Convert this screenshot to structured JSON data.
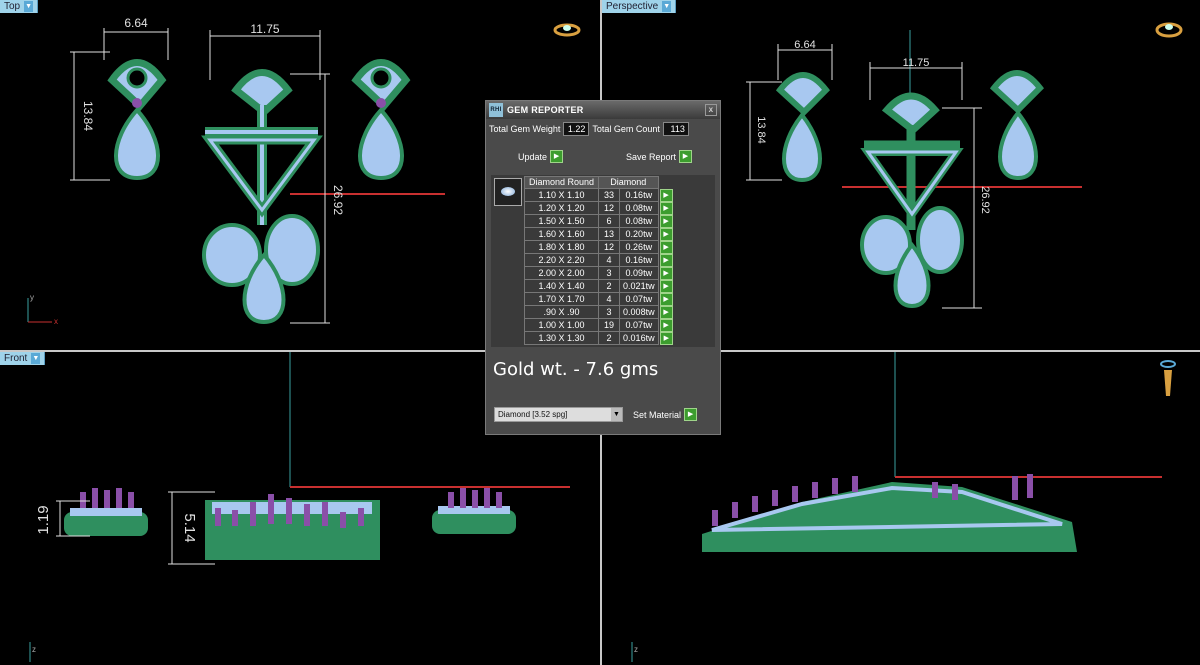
{
  "viewports": {
    "top_label": "Top",
    "perspective_label": "Perspective",
    "front_label": "Front",
    "right_label": ""
  },
  "dimensions": {
    "top_left_width": "6.64",
    "top_center_width": "11.75",
    "top_left_height": "13.84",
    "top_center_height": "26.92",
    "persp_left_width": "6.64",
    "persp_center_width": "11.75",
    "persp_left_height": "13.84",
    "persp_center_height": "26.92",
    "front_left_height": "1.19",
    "front_center_height": "5.14"
  },
  "axes": {
    "top_x": "x",
    "top_y": "y",
    "front_z": "z",
    "right_z": "z"
  },
  "gem_reporter": {
    "title": "GEM REPORTER",
    "logo": "RHI",
    "close": "x",
    "total_weight_label": "Total Gem Weight",
    "total_weight": "1.22",
    "total_count_label": "Total Gem Count",
    "total_count": "113",
    "update_label": "Update",
    "save_report_label": "Save Report",
    "table_header_shape": "Diamond Round",
    "table_header_material": "Diamond",
    "rows": [
      {
        "size": "1.10 X 1.10",
        "qty": "33",
        "tw": "0.16tw"
      },
      {
        "size": "1.20 X 1.20",
        "qty": "12",
        "tw": "0.08tw"
      },
      {
        "size": "1.50 X 1.50",
        "qty": "6",
        "tw": "0.08tw"
      },
      {
        "size": "1.60 X 1.60",
        "qty": "13",
        "tw": "0.20tw"
      },
      {
        "size": "1.80 X 1.80",
        "qty": "12",
        "tw": "0.26tw"
      },
      {
        "size": "2.20 X 2.20",
        "qty": "4",
        "tw": "0.16tw"
      },
      {
        "size": "2.00 X 2.00",
        "qty": "3",
        "tw": "0.09tw"
      },
      {
        "size": "1.40 X 1.40",
        "qty": "2",
        "tw": "0.021tw"
      },
      {
        "size": "1.70 X 1.70",
        "qty": "4",
        "tw": "0.07tw"
      },
      {
        "size": ".90 X .90",
        "qty": "3",
        "tw": "0.008tw"
      },
      {
        "size": "1.00 X 1.00",
        "qty": "19",
        "tw": "0.07tw"
      },
      {
        "size": "1.30 X 1.30",
        "qty": "2",
        "tw": "0.016tw"
      }
    ],
    "gold_weight": "Gold wt. - 7.6 gms",
    "material_selected": "Diamond    [3.52 spg]",
    "set_material_label": "Set Material"
  },
  "colors": {
    "metal": "#2f8f5f",
    "gem": "#a8c8f0",
    "prong": "#8a4fa8",
    "dim_line": "#e0e0e0",
    "axis_red": "#c83030",
    "axis_teal": "#3aa0a0"
  }
}
